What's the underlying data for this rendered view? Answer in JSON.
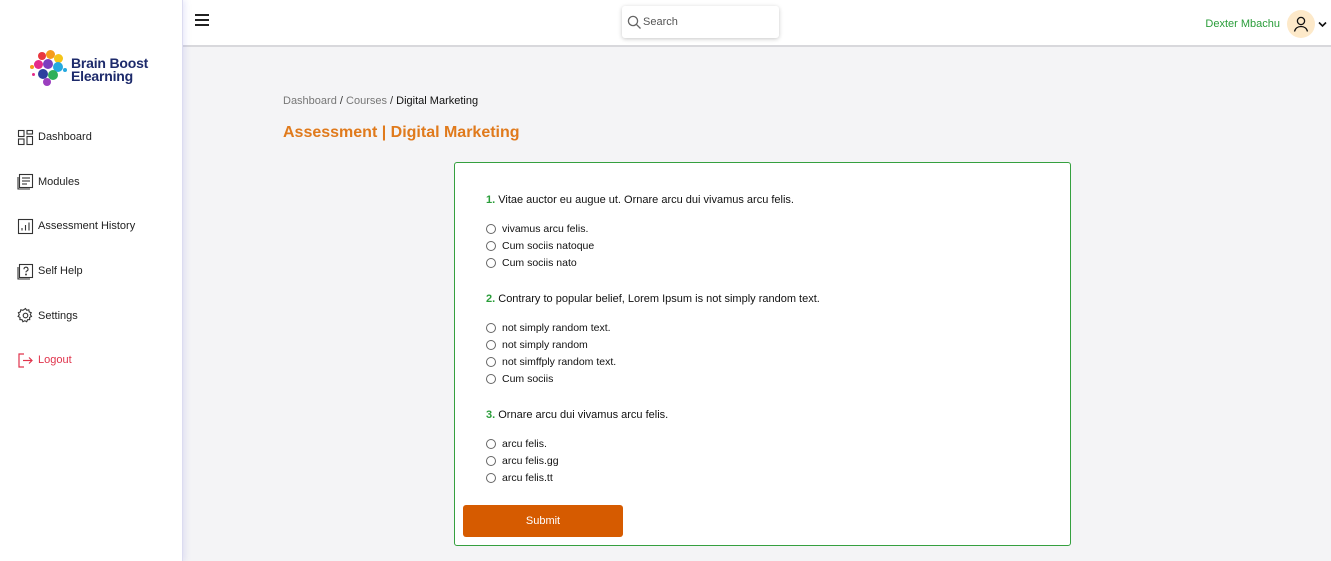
{
  "brand": {
    "line1": "Brain Boost",
    "line2": "Elearning"
  },
  "sidebar": {
    "items": [
      {
        "label": "Dashboard",
        "icon": "dashboard-grid-icon"
      },
      {
        "label": "Modules",
        "icon": "modules-icon"
      },
      {
        "label": "Assessment History",
        "icon": "chart-icon"
      },
      {
        "label": "Self Help",
        "icon": "help-icon"
      },
      {
        "label": "Settings",
        "icon": "gear-icon"
      },
      {
        "label": "Logout",
        "icon": "logout-icon"
      }
    ]
  },
  "topbar": {
    "search_placeholder": "Search",
    "user_name": "Dexter Mbachu"
  },
  "breadcrumb": {
    "crumb1": "Dashboard",
    "crumb2": "Courses",
    "current": "Digital Marketing",
    "separator": "/"
  },
  "page_title": "Assessment | Digital Marketing",
  "questions": [
    {
      "number": "1.",
      "text": "Vitae auctor eu augue ut. Ornare arcu dui vivamus arcu felis.",
      "options": [
        "vivamus arcu felis.",
        "Cum sociis natoque",
        "Cum sociis nato"
      ]
    },
    {
      "number": "2.",
      "text": "Contrary to popular belief, Lorem Ipsum is not simply random text.",
      "options": [
        "not simply random text.",
        "not simply random",
        "not simffply random text.",
        "Cum sociis"
      ]
    },
    {
      "number": "3.",
      "text": "Ornare arcu dui vivamus arcu felis.",
      "options": [
        "arcu felis.",
        "arcu felis.gg",
        "arcu felis.tt"
      ]
    }
  ],
  "submit_label": "Submit",
  "colors": {
    "accent_orange": "#e07a1c",
    "submit_bg": "#d65b00",
    "green": "#2a9d3a",
    "logout_red": "#e0344c"
  }
}
